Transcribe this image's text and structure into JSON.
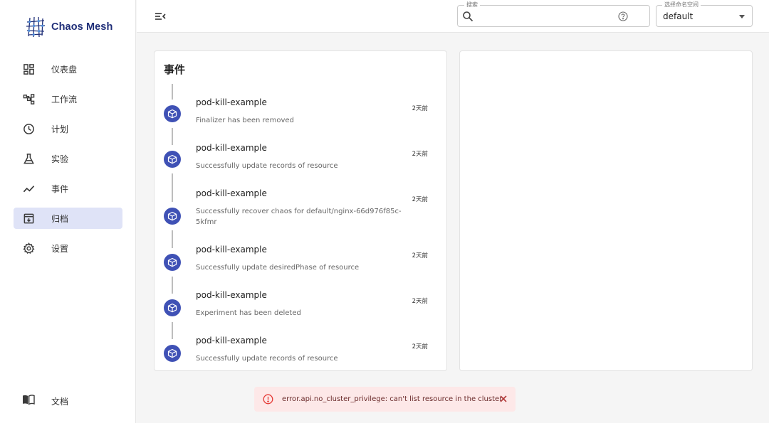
{
  "app": {
    "name": "Chaos Mesh"
  },
  "sidebar": {
    "items": [
      {
        "label": "仪表盘",
        "icon": "dashboard-icon",
        "active": false
      },
      {
        "label": "工作流",
        "icon": "workflow-icon",
        "active": false
      },
      {
        "label": "计划",
        "icon": "clock-icon",
        "active": false
      },
      {
        "label": "实验",
        "icon": "flask-icon",
        "active": false
      },
      {
        "label": "事件",
        "icon": "timeline-icon",
        "active": false
      },
      {
        "label": "归档",
        "icon": "archive-icon",
        "active": true
      },
      {
        "label": "设置",
        "icon": "gear-icon",
        "active": false
      }
    ],
    "docs": {
      "label": "文档",
      "icon": "book-icon"
    }
  },
  "header": {
    "search": {
      "legend": "搜索",
      "value": "",
      "placeholder": ""
    },
    "namespace": {
      "legend": "选择命名空间",
      "value": "default"
    }
  },
  "events": {
    "title": "事件",
    "items": [
      {
        "name": "pod-kill-example",
        "message": "Finalizer has been removed",
        "time": "2天前"
      },
      {
        "name": "pod-kill-example",
        "message": "Successfully update records of resource",
        "time": "2天前"
      },
      {
        "name": "pod-kill-example",
        "message": "Successfully recover chaos for default/nginx-66d976f85c-5kfmr",
        "time": "2天前"
      },
      {
        "name": "pod-kill-example",
        "message": "Successfully update desiredPhase of resource",
        "time": "2天前"
      },
      {
        "name": "pod-kill-example",
        "message": "Experiment has been deleted",
        "time": "2天前"
      },
      {
        "name": "pod-kill-example",
        "message": "Successfully update records of resource",
        "time": "2天前"
      }
    ]
  },
  "toast": {
    "message": "error.api.no_cluster_privilege: can't list resource in the cluster",
    "icon": "error-circle-icon"
  },
  "colors": {
    "primary": "#3f51b5",
    "active_nav_bg": "#dfe3f7",
    "logo_text": "#1f2e78",
    "toast_bg": "#fde8e8",
    "error": "#e53935"
  }
}
